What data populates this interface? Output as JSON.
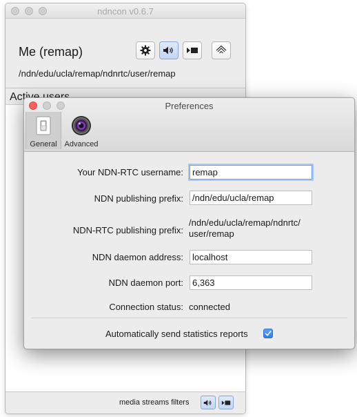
{
  "main_window": {
    "title": "ndncon v0.6.7",
    "user_title": "Me (remap)",
    "user_prefix": "/ndn/edu/ucla/remap/ndnrtc/user/remap",
    "active_users_label": "Active users",
    "bottom_bar": {
      "filters_label": "media streams filters"
    },
    "toolbar_icons": [
      "gear-icon",
      "speaker-icon",
      "video-icon",
      "broadcast-icon"
    ]
  },
  "preferences": {
    "title": "Preferences",
    "tabs": [
      {
        "label": "General",
        "icon": "switch-icon",
        "selected": true
      },
      {
        "label": "Advanced",
        "icon": "camera-lens-icon",
        "selected": false
      }
    ],
    "fields": {
      "username": {
        "label": "Your NDN-RTC username:",
        "value": "remap"
      },
      "publishing_prefix": {
        "label": "NDN publishing prefix:",
        "value": "/ndn/edu/ucla/remap"
      },
      "ndnrtc_prefix": {
        "label": "NDN-RTC publishing prefix:",
        "value_line1": "/ndn/edu/ucla/remap/ndnrtc/",
        "value_line2": "user/remap"
      },
      "daemon_address": {
        "label": "NDN daemon address:",
        "value": "localhost"
      },
      "daemon_port": {
        "label": "NDN daemon port:",
        "value": "6,363"
      },
      "connection_status": {
        "label": "Connection status:",
        "value": "connected"
      }
    },
    "statistics_checkbox": {
      "label": "Automatically send statistics reports",
      "checked": true
    }
  },
  "colors": {
    "accent": "#3b82f0",
    "close_red": "#fc605c"
  }
}
